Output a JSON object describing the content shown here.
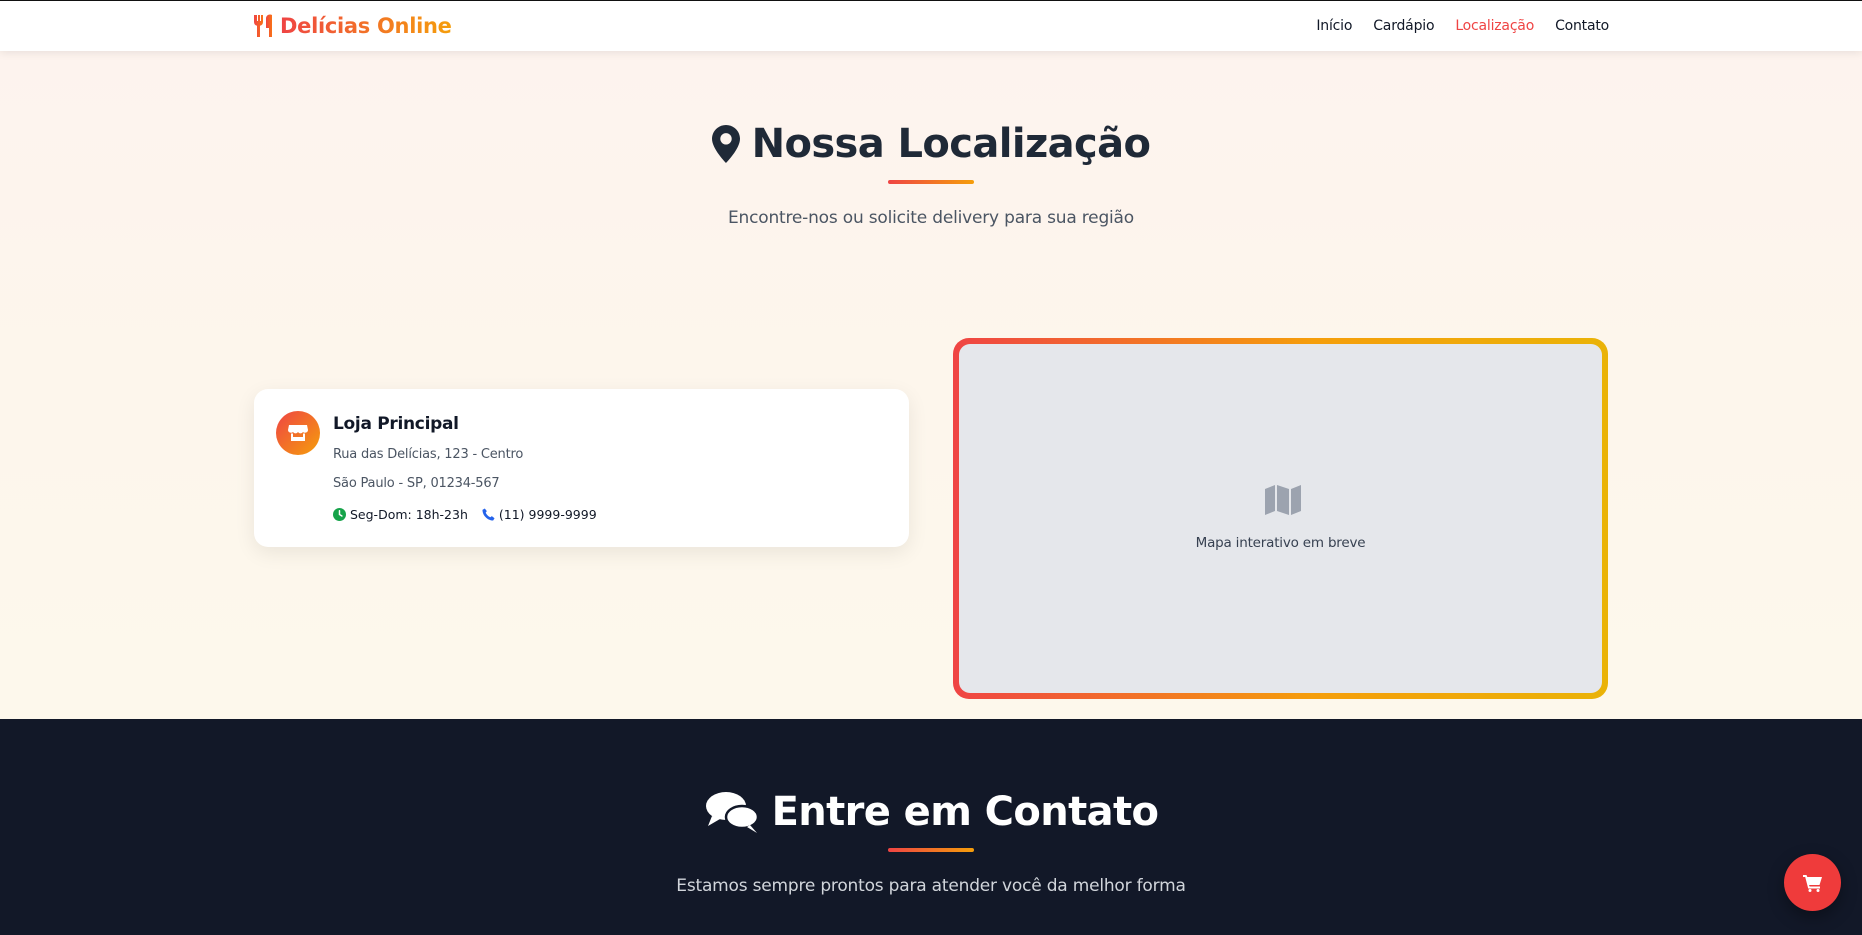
{
  "header": {
    "brand": "Delícias Online",
    "brand_icon": "utensils-icon",
    "nav": [
      {
        "label": "Início",
        "active": false
      },
      {
        "label": "Cardápio",
        "active": false
      },
      {
        "label": "Localização",
        "active": true
      },
      {
        "label": "Contato",
        "active": false
      }
    ]
  },
  "location": {
    "title_icon": "map-pin-icon",
    "title": "Nossa Localização",
    "subtitle": "Encontre-nos ou solicite delivery para sua região",
    "store": {
      "icon": "store-icon",
      "name": "Loja Principal",
      "address_line1": "Rua das Delícias, 123 - Centro",
      "address_line2": "São Paulo - SP, 01234-567",
      "hours_icon": "clock-icon",
      "hours": "Seg-Dom: 18h-23h",
      "phone_icon": "phone-icon",
      "phone": "(11) 9999-9999"
    },
    "map": {
      "icon": "map-icon",
      "placeholder_text": "Mapa interativo em breve"
    }
  },
  "contact": {
    "title_icon": "chat-bubbles-icon",
    "title": "Entre em Contato",
    "subtitle": "Estamos sempre prontos para atender você da melhor forma"
  },
  "cart_fab": {
    "icon": "cart-icon"
  },
  "colors": {
    "accent_red": "#ef4444",
    "accent_amber": "#f59e0b",
    "dark_bg": "#121828",
    "map_bg": "#e5e7eb"
  }
}
